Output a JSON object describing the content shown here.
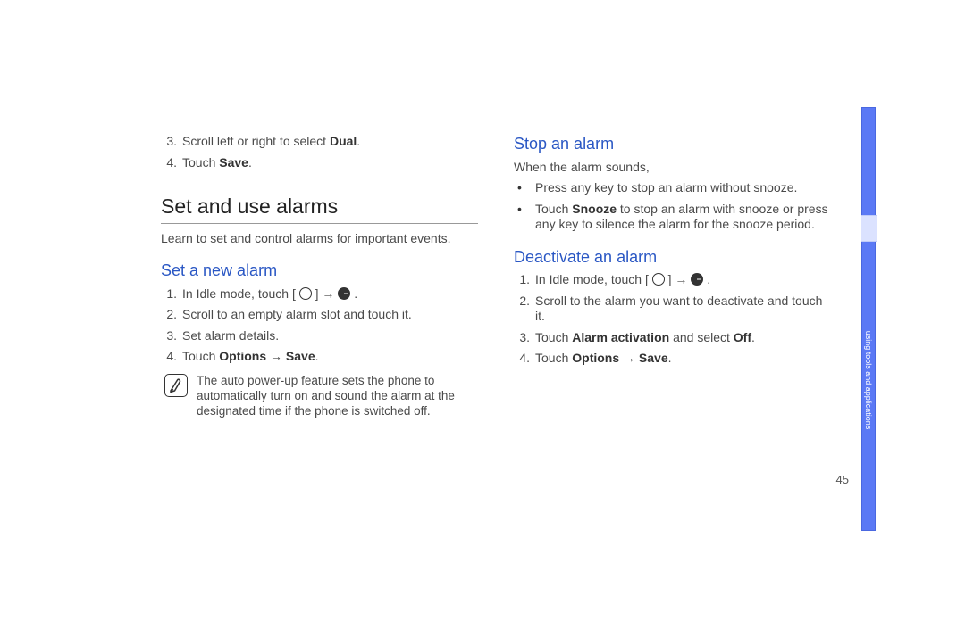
{
  "page_number": "45",
  "side_label": "using tools and applications",
  "left": {
    "pre_steps": [
      {
        "n": "3.",
        "html": "Scroll left or right to select <b>Dual</b>."
      },
      {
        "n": "4.",
        "html": "Touch <b>Save</b>."
      }
    ],
    "h1": "Set and use alarms",
    "intro": "Learn to set and control alarms for important events.",
    "sub1": "Set a new alarm",
    "steps1": [
      {
        "n": "1.",
        "html": "In Idle mode, touch [ <span class='icon-inline' data-name='menu-icon' data-interactable='false'></span> ] → <span class='icon-inline icon-solid clock-hand' data-name='alarm-clock-icon' data-interactable='false'></span> ."
      },
      {
        "n": "2.",
        "html": "Scroll to an empty alarm slot and touch it."
      },
      {
        "n": "3.",
        "html": "Set alarm details."
      },
      {
        "n": "4.",
        "html": "Touch <b>Options</b> → <b>Save</b>."
      }
    ],
    "note": "The auto power-up feature sets the phone to automatically turn on and sound the alarm at the designated time if the phone is switched off."
  },
  "right": {
    "sub1": "Stop an alarm",
    "intro1": "When the alarm sounds,",
    "bullets1": [
      {
        "html": "Press any key to stop an alarm without snooze."
      },
      {
        "html": "Touch <b>Snooze</b> to stop an alarm with snooze or press any key to silence the alarm for the snooze period."
      }
    ],
    "sub2": "Deactivate an alarm",
    "steps2": [
      {
        "n": "1.",
        "html": "In Idle mode, touch [ <span class='icon-inline' data-name='menu-icon' data-interactable='false'></span> ] → <span class='icon-inline icon-solid clock-hand' data-name='alarm-clock-icon' data-interactable='false'></span> ."
      },
      {
        "n": "2.",
        "html": "Scroll to the alarm you want to deactivate and touch it."
      },
      {
        "n": "3.",
        "html": "Touch <b>Alarm activation</b> and select <b>Off</b>."
      },
      {
        "n": "4.",
        "html": "Touch <b>Options</b> → <b>Save</b>."
      }
    ]
  }
}
